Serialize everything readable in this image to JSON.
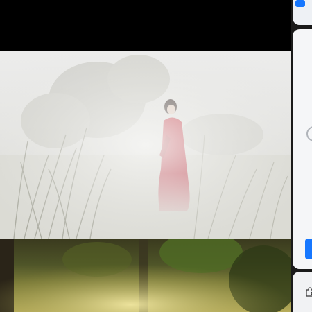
{
  "screen": {
    "background": "#000000",
    "accent_color": "#1677ff"
  },
  "feed": {
    "items": [
      {
        "type": "image",
        "subject": "woman-in-red-robe-in-misty-grass",
        "dominant_colors": [
          "#efefef",
          "#c61b2a",
          "#9a9a88"
        ]
      },
      {
        "type": "image",
        "subject": "sunlit-forest-rocks",
        "dominant_colors": [
          "#3a3a1e",
          "#6b7a2e",
          "#d8c870"
        ]
      }
    ]
  },
  "side_panel": {
    "icons": [
      "blue-tab-icon",
      "loading-spinner-icon",
      "blue-note-icon",
      "puzzle-icon"
    ]
  }
}
